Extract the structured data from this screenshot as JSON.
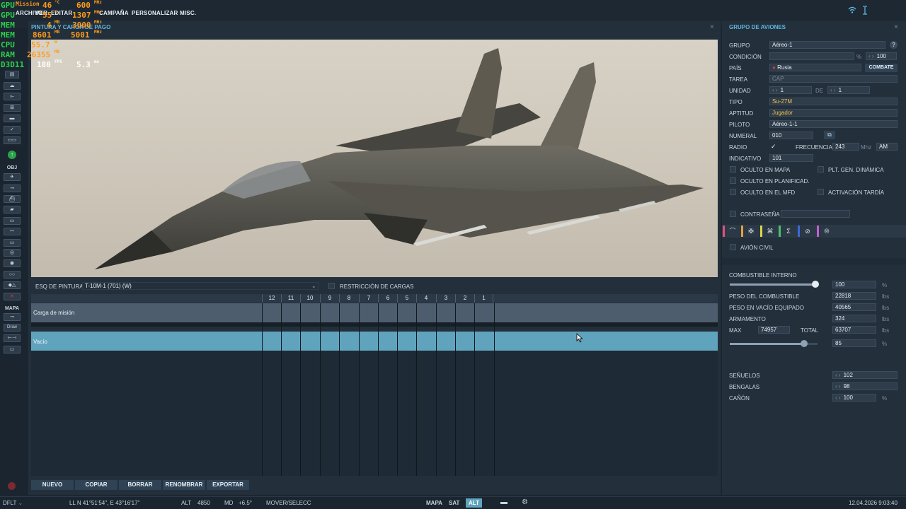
{
  "topbar": {
    "menus": [
      "ARCHIVO",
      "VER",
      "EDITAR",
      "CAMPAÑA",
      "PERSONALIZAR",
      "MISC."
    ],
    "mission_fragment": "Mission"
  },
  "osd": [
    {
      "label": "GPU",
      "value": "46",
      "unit": "°C",
      "value2": "600",
      "unit2": "MHz"
    },
    {
      "label": "GPU",
      "value": "55",
      "unit": "%",
      "value2": "1307",
      "unit2": "MHz"
    },
    {
      "label": "MEM",
      "value": "4",
      "unit": "MB",
      "value2": "3000",
      "unit2": "MHz"
    },
    {
      "label": "MEM",
      "value": "8601",
      "unit": "MB",
      "value2": "5001",
      "unit2": "MHz"
    },
    {
      "label": "CPU",
      "value": "55.7",
      "unit": "W"
    },
    {
      "label": "RAM",
      "value": "26355",
      "unit": "MB"
    },
    {
      "label": "D3D11",
      "value": "180",
      "unit": "FPS",
      "value2": "5.3",
      "unit2": "ms"
    }
  ],
  "left_toolbar": {
    "obj_label": "OBJ",
    "mapa_label": "MAPA",
    "draw_label": "Draw"
  },
  "main": {
    "title": "PINTURA Y CARGA DE PAGO",
    "paint_label": "ESQ DE PINTURA",
    "paint_value": "T-10M-1 (701) (W)",
    "restriction_label": "RESTRICCIÓN DE CARGAS",
    "stations": [
      "12",
      "11",
      "10",
      "9",
      "8",
      "7",
      "6",
      "5",
      "4",
      "3",
      "2",
      "1"
    ],
    "mission_load_label": "Carga de misión",
    "selected_row": "Vacío",
    "buttons": [
      "NUEVO",
      "COPIAR",
      "BORRAR",
      "RENOMBRAR",
      "EXPORTAR"
    ]
  },
  "right": {
    "title": "GRUPO DE AVIONES",
    "grupo_label": "GRUPO",
    "grupo_value": "Aéreo-1",
    "condicion_label": "CONDICIÓN",
    "condicion_unit": "%",
    "condicion_value": "100",
    "pais_label": "PAÍS",
    "pais_value": "Rusia",
    "combate_btn": "COMBATE",
    "tarea_label": "TAREA",
    "tarea_value": "CAP",
    "unidad_label": "UNIDAD",
    "unidad_value": "1",
    "de_label": "DE",
    "de_value": "1",
    "tipo_label": "TIPO",
    "tipo_value": "Su-27M",
    "aptitud_label": "APTITUD",
    "aptitud_value": "Jugador",
    "piloto_label": "PILOTO",
    "piloto_value": "Aéreo-1-1",
    "numeral_label": "NUMERAL",
    "numeral_value": "010",
    "radio_label": "RADIO",
    "frecuencia_label": "FRECUENCIA",
    "frecuencia_value": "243",
    "frecuencia_unit": "Mhz",
    "modulation": "AM",
    "indicativo_label": "INDICATIVO",
    "indicativo_value": "101",
    "oculto_mapa": "OCULTO EN MAPA",
    "plt_gen": "PLT. GEN. DINÁMICA",
    "oculto_plan": "OCULTO EN PLANIFICAD.",
    "oculto_mfd": "OCULTO EN EL MFD",
    "activacion": "ACTIVACIÓN TARDÍA",
    "contrasena": "CONTRASEÑA",
    "avion_civil": "AVIÓN CIVIL",
    "combustible_label": "COMBUSTIBLE INTERNO",
    "combustible_value": "100",
    "pct": "%",
    "peso_comb_label": "PESO DEL COMBUSTIBLE",
    "peso_comb_value": "22818",
    "peso_vacio_label": "PESO EN VACÍO EQUIPADO",
    "peso_vacio_value": "40565",
    "armamento_label": "ARMAMENTO",
    "armamento_value": "324",
    "lbs": "lbs",
    "max_label": "MAX",
    "max_value": "74957",
    "total_label": "TOTAL",
    "total_value": "63707",
    "total_pct_value": "85",
    "senuelos_label": "SEÑUELOS",
    "senuelos_value": "102",
    "bengalas_label": "BENGALAS",
    "bengalas_value": "98",
    "canon_label": "CAÑÓN",
    "canon_value": "100"
  },
  "statusbar": {
    "profile": "DFLT",
    "ll": "LL  N 41°51'54\", E 43°16'17\"",
    "alt_label": "ALT",
    "alt_value": "4850",
    "md_label": "MD",
    "md_value": "+6.5°",
    "mode": "MOVER/SELECC",
    "mapa": "MAPA",
    "sat": "SAT",
    "alt": "ALT",
    "datetime": "12.04.2026 9:03:40"
  },
  "colors": {
    "accent": "#5fb6dd",
    "selected_row": "#5fa3bd",
    "panel": "#23303c",
    "osd_green": "#2bd04a",
    "osd_orange": "#ff9a1c"
  }
}
